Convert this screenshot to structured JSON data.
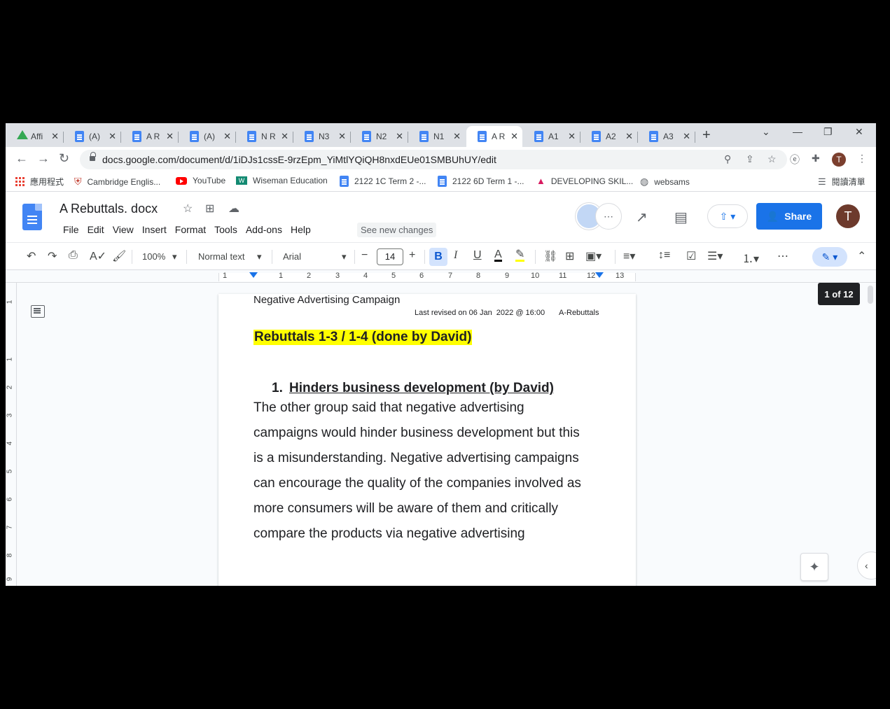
{
  "browser": {
    "tabs": [
      {
        "label": "Affi",
        "icon": "drive-icon",
        "active": false
      },
      {
        "label": "(A)",
        "icon": "docs-icon",
        "active": false
      },
      {
        "label": "A R",
        "icon": "docs-icon",
        "active": false
      },
      {
        "label": "(A)",
        "icon": "docs-icon",
        "active": false
      },
      {
        "label": "N R",
        "icon": "docs-icon",
        "active": false
      },
      {
        "label": "N3",
        "icon": "docs-icon",
        "active": false
      },
      {
        "label": "N2",
        "icon": "docs-icon",
        "active": false
      },
      {
        "label": "N1",
        "icon": "docs-icon",
        "active": false
      },
      {
        "label": "A R",
        "icon": "docs-icon",
        "active": true
      },
      {
        "label": "A1",
        "icon": "docs-icon",
        "active": false
      },
      {
        "label": "A2",
        "icon": "docs-icon",
        "active": false
      },
      {
        "label": "A3",
        "icon": "docs-icon",
        "active": false
      }
    ],
    "url": "docs.google.com/document/d/1iDJs1cssE-9rzEpm_YiMtlYQiQH8nxdEUe01SMBUhUY/edit",
    "profile_initial": "T",
    "bookmarks": [
      {
        "label": "應用程式",
        "icon": "apps-icon"
      },
      {
        "label": "Cambridge Englis...",
        "icon": "cambridge-icon"
      },
      {
        "label": "YouTube",
        "icon": "youtube-icon"
      },
      {
        "label": "Wiseman Education",
        "icon": "wiseman-icon"
      },
      {
        "label": "2122 1C Term 2 -...",
        "icon": "docs-icon"
      },
      {
        "label": "2122 6D Term 1 -...",
        "icon": "docs-icon"
      },
      {
        "label": "DEVELOPING SKIL...",
        "icon": "developing-icon"
      },
      {
        "label": "websams",
        "icon": "globe-icon"
      }
    ],
    "reading_list": "閱讀清單"
  },
  "docs": {
    "title": "A Rebuttals. docx",
    "menus": [
      "File",
      "Edit",
      "View",
      "Insert",
      "Format",
      "Tools",
      "Add-ons",
      "Help"
    ],
    "see_changes": "See new changes",
    "share_label": "Share",
    "user_initial": "T",
    "toolbar": {
      "zoom": "100%",
      "style": "Normal text",
      "font": "Arial",
      "font_size": "14"
    },
    "ruler_numbers": [
      "1",
      "1",
      "2",
      "3",
      "4",
      "5",
      "6",
      "7",
      "8",
      "9",
      "10",
      "11",
      "12",
      "13"
    ],
    "vruler_numbers": [
      "1",
      "1",
      "2",
      "3",
      "4",
      "5",
      "6",
      "7",
      "8",
      "9"
    ],
    "page_count": "1 of 12"
  },
  "document": {
    "header_title": "Negative Advertising Campaign",
    "header_revised": "Last revised on 06 Jan  2022 @ 16:00",
    "header_tag": "A-Rebuttals",
    "heading": "Rebuttals 1-3 / 1-4 (done by David)",
    "list_number": "1.",
    "list_title": "Hinders business development (by David)",
    "body_lines": [
      "The other group said that negative advertising",
      "campaigns would hinder business development but this",
      "is a misunderstanding. Negative advertising campaigns",
      "can encourage the quality of the companies involved as",
      "more consumers will be aware of them and critically",
      "compare the products via negative advertising"
    ]
  }
}
